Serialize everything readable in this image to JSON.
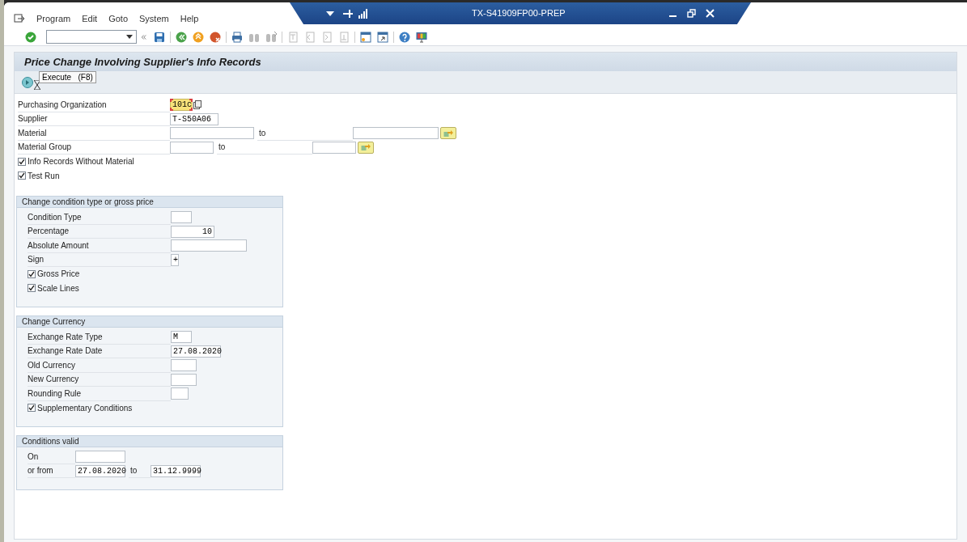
{
  "window": {
    "title": "TX-S41909FP00-PREP"
  },
  "menu": [
    {
      "label": "Program"
    },
    {
      "label": "Edit"
    },
    {
      "label": "Goto"
    },
    {
      "label": "System"
    },
    {
      "label": "Help"
    }
  ],
  "title": "Price Change Involving Supplier's Info Records",
  "tooltip": "Execute   (F8)",
  "selection": [
    {
      "kind": "field",
      "label": "Purchasing Organization",
      "value": "101c",
      "focused": true
    },
    {
      "kind": "field",
      "label": "Supplier",
      "value": "T-S50A06",
      "focused": false
    },
    {
      "kind": "range",
      "label": "Material",
      "to_label": "to"
    },
    {
      "kind": "range",
      "label": "Material Group",
      "to_label": "to"
    },
    {
      "kind": "checkbox",
      "label": "Info Records Without Material",
      "checked": true
    },
    {
      "kind": "checkbox",
      "label": "Test Run",
      "checked": true
    }
  ],
  "groups": [
    {
      "title": "Change condition type or gross price",
      "rows": [
        {
          "kind": "field",
          "label": "Condition Type"
        },
        {
          "kind": "number",
          "label": "Percentage",
          "value": "10"
        },
        {
          "kind": "field",
          "label": "Absolute Amount"
        },
        {
          "kind": "field",
          "label": "Sign",
          "value": "+"
        },
        {
          "kind": "checkbox",
          "label": "Gross Price",
          "checked": true
        },
        {
          "kind": "checkbox",
          "label": "Scale Lines",
          "checked": true
        }
      ]
    },
    {
      "title": "Change Currency",
      "rows": [
        {
          "kind": "field",
          "label": "Exchange Rate Type",
          "value": "M"
        },
        {
          "kind": "field",
          "label": "Exchange Rate Date",
          "value": "27.08.2020"
        },
        {
          "kind": "field",
          "label": "Old Currency"
        },
        {
          "kind": "field",
          "label": "New Currency"
        },
        {
          "kind": "field",
          "label": "Rounding Rule"
        },
        {
          "kind": "checkbox",
          "label": "Supplementary Conditions",
          "checked": true
        }
      ]
    },
    {
      "title": "Conditions valid",
      "rows": [
        {
          "kind": "date",
          "label": "On"
        },
        {
          "kind": "daterange",
          "label": "or from",
          "value": "27.08.2020",
          "to_label": "to",
          "to_value": "31.12.9999"
        }
      ]
    }
  ]
}
